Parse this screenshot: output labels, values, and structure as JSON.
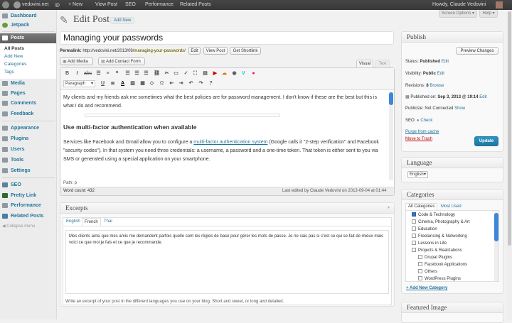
{
  "adminbar": {
    "site": "vedovini.net",
    "comments": "",
    "new": "+ New",
    "view_post": "View Post",
    "seo": "SEO",
    "performance": "Performance",
    "related": "Related Posts",
    "howdy": "Howdy, Claude Vedovini"
  },
  "sidebar": {
    "items": [
      {
        "label": "Dashboard",
        "name": "dashboard"
      },
      {
        "label": "Jetpack",
        "name": "jetpack"
      },
      {
        "label": "Posts",
        "name": "posts"
      },
      {
        "label": "Media",
        "name": "media"
      },
      {
        "label": "Pages",
        "name": "pages"
      },
      {
        "label": "Comments",
        "name": "comments"
      },
      {
        "label": "Feedback",
        "name": "feedback"
      },
      {
        "label": "Appearance",
        "name": "appearance"
      },
      {
        "label": "Plugins",
        "name": "plugins"
      },
      {
        "label": "Users",
        "name": "users"
      },
      {
        "label": "Tools",
        "name": "tools"
      },
      {
        "label": "Settings",
        "name": "settings"
      },
      {
        "label": "SEO",
        "name": "seo"
      },
      {
        "label": "Pretty Link",
        "name": "pretty-link"
      },
      {
        "label": "Performance",
        "name": "performance"
      },
      {
        "label": "Related Posts",
        "name": "related-posts"
      }
    ],
    "sub": [
      "All Posts",
      "Add New",
      "Categories",
      "Tags"
    ],
    "collapse": "Collapse menu"
  },
  "screen": {
    "options": "Screen Options ▾",
    "help": "Help ▾"
  },
  "page": {
    "title": "Edit Post",
    "add_new": "Add New"
  },
  "post": {
    "title": "Managing your passwords",
    "permalink_label": "Permalink:",
    "permalink_base": "http://vedovini.net/2013/09/",
    "permalink_slug": "managing-your-passwords",
    "permalink_end": "/",
    "edit": "Edit",
    "view": "View Post",
    "shortlink": "Get Shortlink"
  },
  "editor": {
    "add_media": "Add Media",
    "add_contact": "Add Contact Form",
    "tab_visual": "Visual",
    "tab_text": "Text",
    "format": "Paragraph",
    "p1": "My clients and my friends ask me sometimes what the best policies are for password management. I don't know if these are the best but this is what I do and recommend.",
    "heading": "Use multi-factor authentication when available",
    "p2a": "Services like Facebook and Gmail allow you to configure a ",
    "p2link": "multi-factor authentication system",
    "p2b": " (Google calls it \"2-step verification\" and Facebook \"security codes\"). In that system you need three credentials: a username, a password and a one-time token. That token is either sent to you via SMS or generated using a special application on your smartphone.",
    "path": "Path: p",
    "word_count": "Word count: 432",
    "last_edited": "Last edited by Claude Vedovini on 2013-09-04 at 01:44"
  },
  "excerpts": {
    "title": "Excerpts",
    "tabs": [
      "English",
      "French",
      "Thai"
    ],
    "text": "Mes clients ainsi que mes amis me demandent parfois quelle sont les règles de base pour gérer les mots de passe. Je ne sais pas si c'est ce qui se fait de mieux mais voici ce que moi je fais et ce que je recommande.",
    "help": "Write an excerpt of your post in the different languages you use on your blog. Short and sweet, or long and detailed."
  },
  "publish": {
    "title": "Publish",
    "preview": "Preview Changes",
    "status_label": "Status:",
    "status": "Published",
    "visibility_label": "Visibility:",
    "visibility": "Public",
    "revisions_label": "Revisions:",
    "revisions": "8",
    "browse": "Browse",
    "published_label": "Published on:",
    "published": "Sep 3, 2013 @ 19:14",
    "edit": "Edit",
    "publicize_label": "Publicize:",
    "publicize": "Not Connected",
    "show": "Show",
    "seo_label": "SEO:",
    "check": "Check",
    "purge": "Purge from cache",
    "trash": "Move to Trash",
    "update": "Update"
  },
  "language": {
    "title": "Language",
    "value": "English"
  },
  "categories": {
    "title": "Categories",
    "tab_all": "All Categories",
    "tab_used": "Most Used",
    "items": [
      {
        "label": "Code & Technology",
        "checked": true,
        "indent": 0
      },
      {
        "label": "Cinema, Photography & Art",
        "checked": false,
        "indent": 0
      },
      {
        "label": "Education",
        "checked": false,
        "indent": 0
      },
      {
        "label": "Freelancing & Networking",
        "checked": false,
        "indent": 0
      },
      {
        "label": "Lessons in Life",
        "checked": false,
        "indent": 0
      },
      {
        "label": "Projects & Realizations",
        "checked": false,
        "indent": 0
      },
      {
        "label": "Drupal Plugins",
        "checked": false,
        "indent": 1
      },
      {
        "label": "Facebook Applications",
        "checked": false,
        "indent": 1
      },
      {
        "label": "Others",
        "checked": false,
        "indent": 1
      },
      {
        "label": "WordPress Plugins",
        "checked": false,
        "indent": 1
      }
    ],
    "add_new": "+ Add New Category"
  },
  "featured": {
    "title": "Featured Image"
  },
  "colors": {
    "link": "#21759b",
    "primary": "#278ab7",
    "trash": "#bc0b0b",
    "slug_highlight": "#fffbcc"
  }
}
